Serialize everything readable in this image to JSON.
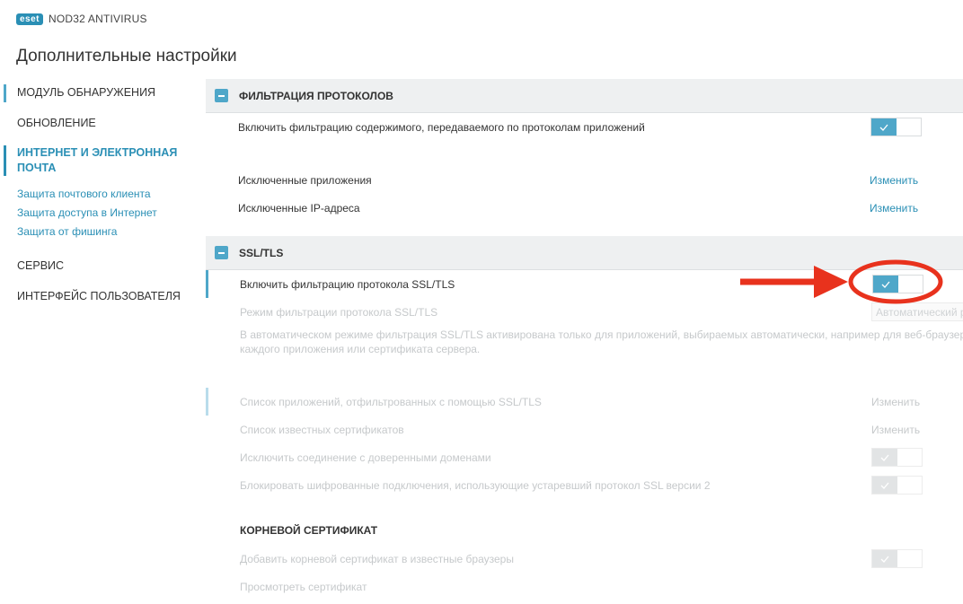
{
  "app": {
    "logo": "eset",
    "product": "NOD32 ANTIVIRUS"
  },
  "page_title": "Дополнительные настройки",
  "sidebar": {
    "items": [
      {
        "label": "МОДУЛЬ ОБНАРУЖЕНИЯ"
      },
      {
        "label": "ОБНОВЛЕНИЕ"
      },
      {
        "label": "ИНТЕРНЕТ И ЭЛЕКТРОННАЯ ПОЧТА"
      },
      {
        "label": "СЕРВИС"
      },
      {
        "label": "ИНТЕРФЕЙС ПОЛЬЗОВАТЕЛЯ"
      }
    ],
    "subitems": [
      {
        "label": "Защита почтового клиента"
      },
      {
        "label": "Защита доступа в Интернет"
      },
      {
        "label": "Защита от фишинга"
      }
    ]
  },
  "protocol_filtering": {
    "title": "ФИЛЬТРАЦИЯ ПРОТОКОЛОВ",
    "enable_label": "Включить фильтрацию содержимого, передаваемого по протоколам приложений",
    "enable_on": true,
    "excluded_apps_label": "Исключенные приложения",
    "excluded_ips_label": "Исключенные IP-адреса",
    "change_label": "Изменить"
  },
  "ssl": {
    "title": "SSL/TLS",
    "enable_label": "Включить фильтрацию протокола SSL/TLS",
    "enable_on": true,
    "mode_label": "Режим фильтрации протокола SSL/TLS",
    "mode_value": "Автоматический режим",
    "description_line1": "В автоматическом режиме фильтрация SSL/TLS активирована только для приложений, выбираемых автоматически, например для веб-браузеров и",
    "description_line2": "каждого приложения или сертификата сервера.",
    "app_list_label": "Список приложений, отфильтрованных с помощью SSL/TLS",
    "known_certs_label": "Список известных сертификатов",
    "exclude_trusted_label": "Исключить соединение с доверенными доменами",
    "block_sslv2_label": "Блокировать шифрованные подключения, использующие устаревший протокол SSL версии 2",
    "change_label": "Изменить"
  },
  "root_cert": {
    "title": "КОРНЕВОЙ СЕРТИФИКАТ",
    "add_label": "Добавить корневой сертификат в известные браузеры",
    "view_label": "Просмотреть сертификат"
  },
  "colors": {
    "accent": "#2a8fb5",
    "toggle_on": "#4fa7c9",
    "annotation": "#e8321d"
  }
}
